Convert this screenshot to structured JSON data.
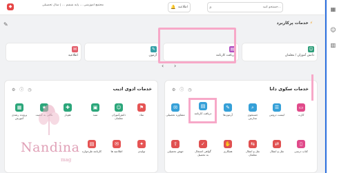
{
  "topbar": {
    "search_placeholder": "جستجو کنید...",
    "notifications_label": "اطلاعیه",
    "user_info": "مجتمع آموزشی ... پایه ششم ... | سال تحصیلی"
  },
  "sidebar": {
    "items": [
      "apps-icon",
      "user-group-icon",
      "building-icon"
    ]
  },
  "favorites": {
    "title": "خدمات پرکاربرد",
    "cards": [
      {
        "label": "اطلاعیه",
        "color": "#e35d6a"
      },
      {
        "label": "آزمون",
        "color": "#35a0a8"
      },
      {
        "label": "دریافت کارنامه",
        "color": "#b04fc0"
      },
      {
        "label": "دانش آموزان / معلمان",
        "color": "#2e9e7a"
      }
    ]
  },
  "panel_left": {
    "title": "خدمات ادوی ادیب",
    "tiles": [
      {
        "label": "نماد",
        "color": "#e55454"
      },
      {
        "label": "دانش‌آموزان معلمان",
        "color": "#2ba67a"
      },
      {
        "label": "سبد",
        "color": "#2ba67a"
      },
      {
        "label": "هم‌یار",
        "color": "#2ba67a"
      },
      {
        "label": "نکاتی به کیفیت",
        "color": "#2ba67a"
      },
      {
        "label": "پرونده رشدی آموزش",
        "color": "#2ba67a"
      },
      {
        "label": "تولیدی",
        "color": "#e55454"
      },
      {
        "label": "اطلاعیه ها",
        "color": "#e55454"
      },
      {
        "label": "کارنامه طرحواره",
        "color": "#e55454"
      }
    ]
  },
  "panel_right": {
    "title": "خدمات سکوی دانا",
    "tiles": [
      {
        "label": "کارت",
        "color": "#e04a8a"
      },
      {
        "label": "لیست دروس",
        "color": "#35a0d8"
      },
      {
        "label": "جستجوی مدارس",
        "color": "#35a0d8"
      },
      {
        "label": "آزمون‌ها",
        "color": "#35a0d8"
      },
      {
        "label": "دریافت کارنامه",
        "color": "#35a0d8"
      },
      {
        "label": "مشاوره تحصیلی",
        "color": "#35a0d8"
      },
      {
        "label": "کتاب درسی",
        "color": "#e04a8a"
      },
      {
        "label": "نقل و انتقال",
        "color": "#e05050"
      },
      {
        "label": "نقل و انتقال معلمان",
        "color": "#e05050"
      },
      {
        "label": "همکاری",
        "color": "#e05050"
      },
      {
        "label": "گواهی اشتغال به تحصیل",
        "color": "#e05050"
      },
      {
        "label": "جهش تحصیلی",
        "color": "#e05050"
      }
    ]
  },
  "brand": {
    "name": "Nandina",
    "sub": "mag"
  }
}
